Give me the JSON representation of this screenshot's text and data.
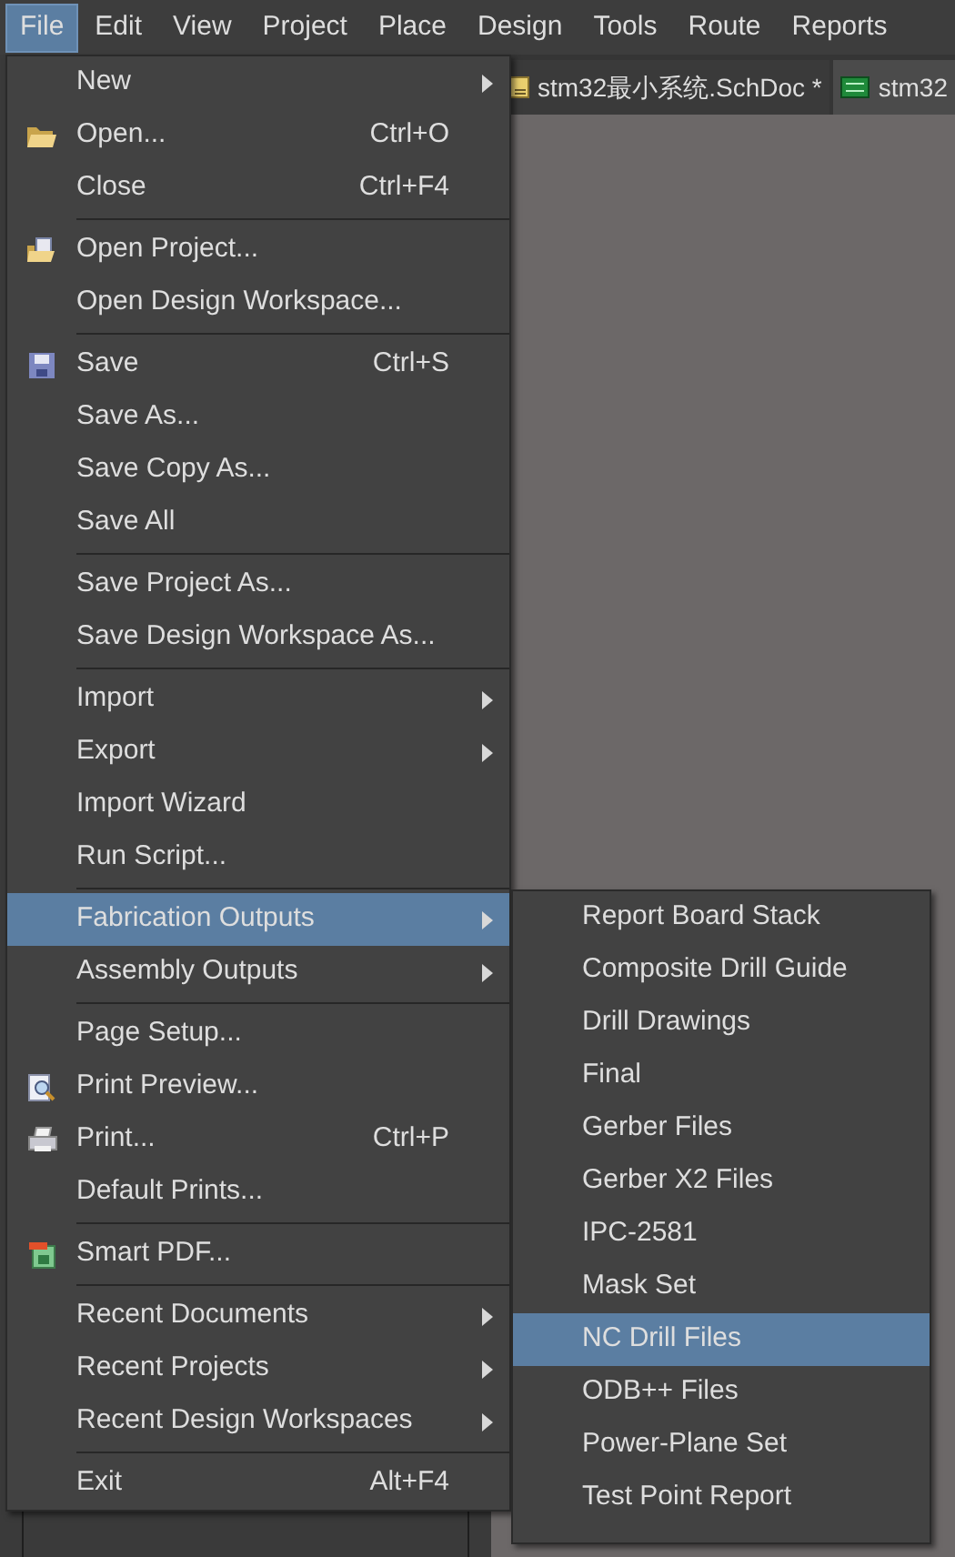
{
  "menubar": [
    {
      "label": "File",
      "selected": true
    },
    {
      "label": "Edit",
      "selected": false
    },
    {
      "label": "View",
      "selected": false
    },
    {
      "label": "Project",
      "selected": false
    },
    {
      "label": "Place",
      "selected": false
    },
    {
      "label": "Design",
      "selected": false
    },
    {
      "label": "Tools",
      "selected": false
    },
    {
      "label": "Route",
      "selected": false
    },
    {
      "label": "Reports",
      "selected": false
    }
  ],
  "tabs": [
    {
      "label": "stm32最小系统.SchDoc *",
      "kind": "schematic",
      "selected": false
    },
    {
      "label": "stm32",
      "kind": "pcb",
      "selected": true
    }
  ],
  "file_menu": [
    {
      "kind": "submenu",
      "label": "New",
      "selected": false
    },
    {
      "kind": "folder",
      "label": "Open...",
      "shortcut": "Ctrl+O",
      "selected": false
    },
    {
      "kind": "plain",
      "label": "Close",
      "shortcut": "Ctrl+F4",
      "selected": false
    },
    {
      "kind": "separator"
    },
    {
      "kind": "project",
      "label": "Open Project...",
      "selected": false
    },
    {
      "kind": "plain",
      "label": "Open Design Workspace...",
      "selected": false
    },
    {
      "kind": "separator"
    },
    {
      "kind": "save",
      "label": "Save",
      "shortcut": "Ctrl+S",
      "selected": false
    },
    {
      "kind": "plain",
      "label": "Save As...",
      "selected": false
    },
    {
      "kind": "plain",
      "label": "Save Copy As...",
      "selected": false
    },
    {
      "kind": "plain",
      "label": "Save All",
      "selected": false
    },
    {
      "kind": "separator"
    },
    {
      "kind": "plain",
      "label": "Save Project As...",
      "selected": false
    },
    {
      "kind": "plain",
      "label": "Save Design Workspace As...",
      "selected": false
    },
    {
      "kind": "separator"
    },
    {
      "kind": "submenu",
      "label": "Import",
      "selected": false
    },
    {
      "kind": "submenu",
      "label": "Export",
      "selected": false
    },
    {
      "kind": "plain",
      "label": "Import Wizard",
      "selected": false
    },
    {
      "kind": "plain",
      "label": "Run Script...",
      "selected": false
    },
    {
      "kind": "separator"
    },
    {
      "kind": "submenu",
      "label": "Fabrication Outputs",
      "selected": true
    },
    {
      "kind": "submenu",
      "label": "Assembly Outputs",
      "selected": false
    },
    {
      "kind": "separator"
    },
    {
      "kind": "plain",
      "label": "Page Setup...",
      "selected": false
    },
    {
      "kind": "preview",
      "label": "Print Preview...",
      "selected": false
    },
    {
      "kind": "print",
      "label": "Print...",
      "shortcut": "Ctrl+P",
      "selected": false
    },
    {
      "kind": "plain",
      "label": "Default Prints...",
      "selected": false
    },
    {
      "kind": "separator"
    },
    {
      "kind": "pdf",
      "label": "Smart PDF...",
      "selected": false
    },
    {
      "kind": "separator"
    },
    {
      "kind": "submenu",
      "label": "Recent Documents",
      "selected": false
    },
    {
      "kind": "submenu",
      "label": "Recent Projects",
      "selected": false
    },
    {
      "kind": "submenu",
      "label": "Recent Design Workspaces",
      "selected": false
    },
    {
      "kind": "separator"
    },
    {
      "kind": "plain",
      "label": "Exit",
      "shortcut": "Alt+F4",
      "selected": false
    }
  ],
  "fabrication_submenu": [
    {
      "label": "Report Board Stack",
      "selected": false
    },
    {
      "label": "Composite Drill Guide",
      "selected": false
    },
    {
      "label": "Drill Drawings",
      "selected": false
    },
    {
      "label": "Final",
      "selected": false
    },
    {
      "label": "Gerber Files",
      "selected": false
    },
    {
      "label": "Gerber X2 Files",
      "selected": false
    },
    {
      "label": "IPC-2581",
      "selected": false
    },
    {
      "label": "Mask Set",
      "selected": false
    },
    {
      "label": "NC Drill Files",
      "selected": true
    },
    {
      "label": "ODB++ Files",
      "selected": false
    },
    {
      "label": "Power-Plane Set",
      "selected": false
    },
    {
      "label": "Test Point Report",
      "selected": false
    }
  ]
}
